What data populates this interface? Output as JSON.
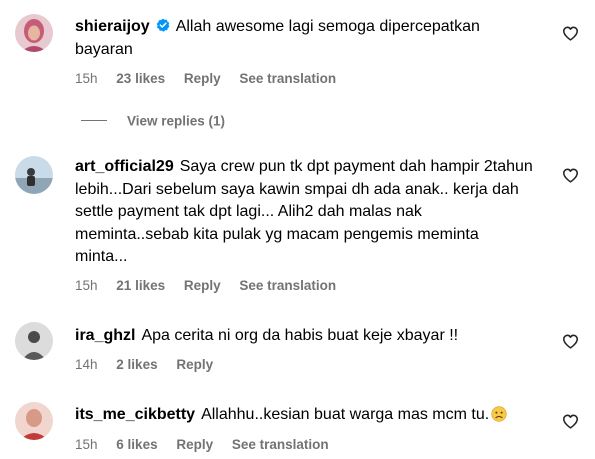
{
  "comments": [
    {
      "username": "shieraijoy",
      "verified": true,
      "text": "Allah awesome lagi semoga dipercepatkan bayaran",
      "time": "15h",
      "likes": "23 likes",
      "reply": "Reply",
      "translate": "See translation",
      "view_replies": "View replies (1)"
    },
    {
      "username": "art_official29",
      "verified": false,
      "text": "Saya crew pun tk dpt payment dah hampir 2tahun lebih...Dari sebelum saya kawin smpai dh ada anak.. kerja dah settle payment tak dpt lagi... Alih2 dah malas nak meminta..sebab kita pulak yg macam pengemis meminta minta...",
      "time": "15h",
      "likes": "21 likes",
      "reply": "Reply",
      "translate": "See translation"
    },
    {
      "username": "ira_ghzl",
      "verified": false,
      "text": "Apa cerita ni org da habis buat keje xbayar !!",
      "time": "14h",
      "likes": "2 likes",
      "reply": "Reply"
    },
    {
      "username": "its_me_cikbetty",
      "verified": false,
      "text": "Allahhu..kesian buat warga mas mcm tu.",
      "emoji": "sad-face-emoji",
      "time": "15h",
      "likes": "6 likes",
      "reply": "Reply",
      "translate": "See translation"
    }
  ],
  "colors": {
    "text": "#000000",
    "meta": "#737373",
    "verified": "#0095f6"
  }
}
